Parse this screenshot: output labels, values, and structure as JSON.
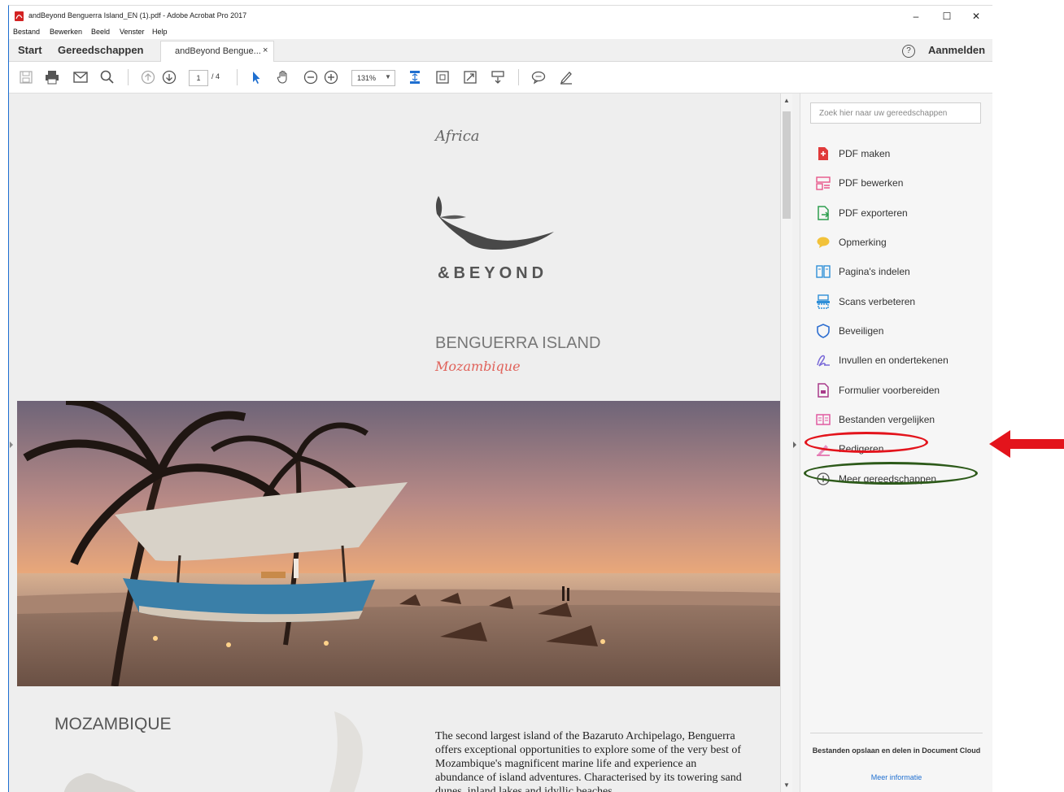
{
  "window": {
    "title": "andBeyond Benguerra Island_EN (1).pdf - Adobe Acrobat Pro 2017",
    "minimize": "–",
    "maximize": "☐",
    "close": "✕"
  },
  "menu": [
    "Bestand",
    "Bewerken",
    "Beeld",
    "Venster",
    "Help"
  ],
  "tabs": {
    "home": "Start",
    "tools": "Gereedschappen",
    "document": "andBeyond Bengue...",
    "document_close": "×",
    "help": "?",
    "signin": "Aanmelden"
  },
  "toolbar": {
    "page_current": "1",
    "page_total": "/ 4",
    "zoom": "131%",
    "zoom_arrow": "▼"
  },
  "document": {
    "africa": "Africa",
    "logo": "&BEYOND",
    "island": "BENGUERRA ISLAND",
    "country_script": "Mozambique",
    "section_title": "MOZAMBIQUE",
    "body": "The second largest island of the Bazaruto Archipelago, Benguerra offers exceptional opportunities to explore some of the very best of Mozambique's magnificent marine life and experience an abundance of island adventures. Characterised by its towering sand dunes, inland lakes and idyllic beaches"
  },
  "scrollbar": {
    "up": "▲",
    "down": "▼"
  },
  "tools_pane": {
    "search_placeholder": "Zoek hier naar uw gereedschappen",
    "items": [
      {
        "label": "PDF maken",
        "icon": "pdf-create-icon",
        "color": "#e03a3a"
      },
      {
        "label": "PDF bewerken",
        "icon": "pdf-edit-icon",
        "color": "#e8578a"
      },
      {
        "label": "PDF exporteren",
        "icon": "pdf-export-icon",
        "color": "#2e9e4f"
      },
      {
        "label": "Opmerking",
        "icon": "comment-icon",
        "color": "#f2b31a"
      },
      {
        "label": "Pagina's indelen",
        "icon": "organize-pages-icon",
        "color": "#2f8fd8"
      },
      {
        "label": "Scans verbeteren",
        "icon": "enhance-scan-icon",
        "color": "#2f8fd8"
      },
      {
        "label": "Beveiligen",
        "icon": "shield-icon",
        "color": "#2f6fd0"
      },
      {
        "label": "Invullen en ondertekenen",
        "icon": "fill-sign-icon",
        "color": "#7a6ad8"
      },
      {
        "label": "Formulier voorbereiden",
        "icon": "form-icon",
        "color": "#a83a8a"
      },
      {
        "label": "Bestanden vergelijken",
        "icon": "compare-icon",
        "color": "#e05aa0"
      },
      {
        "label": "Redigeren",
        "icon": "redact-icon",
        "color": "#e05aa0"
      },
      {
        "label": "Meer gereedschappen",
        "icon": "plus-circle-icon",
        "color": "#555555"
      }
    ],
    "cloud_text": "Bestanden opslaan en delen in Document Cloud",
    "cloud_link": "Meer informatie"
  },
  "colors": {
    "accent_blue": "#1f6fd0",
    "annotation_red": "#e3141c",
    "annotation_green": "#2d5a1a"
  }
}
